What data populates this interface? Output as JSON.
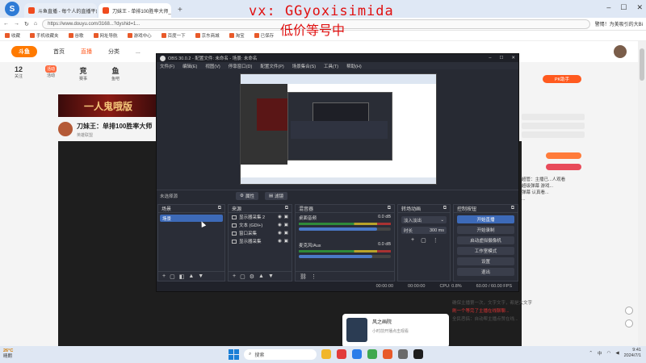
{
  "watermark": {
    "line1": "vx: GGyoxisimida",
    "line2": "低价等号中"
  },
  "browser": {
    "tabs": [
      {
        "label": "斗鱼直播 - 每个人的直播平台"
      },
      {
        "label": "刀妹王 - 单排100胜率大师_英雄联盟"
      }
    ],
    "add_tab": "+",
    "url": "https://www.douyu.com/3168...?dyshid=1...",
    "right_text": "警惕！为美吸引的大Bi"
  },
  "bookmarks": [
    "收藏",
    "手机收藏夹",
    "谷歌",
    "网址导航",
    "游戏中心",
    "百度一下",
    "京东商城",
    "淘宝",
    "已保存"
  ],
  "site": {
    "logo": "斗鱼",
    "nav": [
      "首页",
      "直播",
      "分类",
      "..."
    ],
    "side_icons": [
      {
        "top": "12",
        "label": "关注"
      },
      {
        "top": "活动",
        "label": "活动"
      },
      {
        "top": "竞",
        "label": "赛事"
      },
      {
        "top": "鱼",
        "label": "鱼吧"
      }
    ],
    "banner": "一人鬼哦版",
    "streamer": {
      "name": "刀妹王：单排100胜率大师",
      "sub": "英雄联盟"
    },
    "pk_button": "PK助手",
    "chat_lines": [
      {
        "hl": "",
        "text": "超管：主播已...人观看"
      },
      {
        "hl": "",
        "text": "超级弹幕 游戏..."
      },
      {
        "hl": "",
        "text": "弹幕 认真看..."
      },
      {
        "hl": "",
        "text": "..."
      }
    ],
    "promo": {
      "title": "风之画院",
      "sub": "小时前开播点击观看"
    },
    "bottom_chat": [
      "确保主播第一次，文字文字，都是大文字",
      "刷一个等完了主播在线聊聊...",
      "全民恶搞：自动帮主播点赞在线..."
    ]
  },
  "obs": {
    "title": "OBS 30.0.2 - 配置文件: 未命名 - 场景: 未命名",
    "menu": [
      "文件(F)",
      "编辑(E)",
      "视图(V)",
      "停靠窗口(D)",
      "配置文件(P)",
      "场景集合(S)",
      "工具(T)",
      "帮助(H)"
    ],
    "toolbar": {
      "label": "未选择源",
      "settings": "属性",
      "filters": "滤镜"
    },
    "docks": {
      "scenes": {
        "title": "场景",
        "items": [
          "场景"
        ]
      },
      "sources": {
        "title": "来源",
        "items": [
          "显示器采集 2",
          "文本 (GDI+)",
          "窗口采集",
          "显示器采集"
        ]
      },
      "mixer": {
        "title": "混音器",
        "channels": [
          {
            "name": "桌面音频",
            "db": "0.0 dB",
            "level": 0.85
          },
          {
            "name": "麦克风/Aux",
            "db": "0.0 dB",
            "level": 0.8
          }
        ]
      },
      "transitions": {
        "title": "转场动画",
        "selected": "淡入淡出",
        "duration_label": "时长",
        "duration": "300 ms"
      },
      "controls": {
        "title": "控制按钮",
        "buttons": [
          "开始直播",
          "开始录制",
          "启动虚拟摄像机",
          "工作室模式",
          "设置",
          "退出"
        ]
      }
    },
    "status": [
      "00:00:00",
      "00:00:00",
      "CPU: 0.8%",
      "60.00 / 60.00 FPS"
    ]
  },
  "taskbar": {
    "weather_temp": "26°C",
    "weather_desc": "晴朗",
    "search": "搜索",
    "time": "9:41",
    "date": "2024/7/1",
    "lang": "中"
  }
}
